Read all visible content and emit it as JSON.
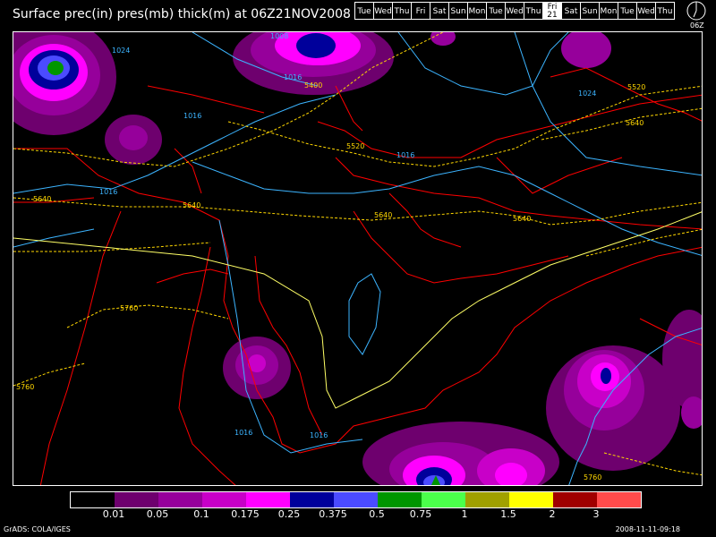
{
  "title": "Surface prec(in) pres(mb) thick(m) at 06Z21NOV2008",
  "days": [
    "Tue",
    "Wed",
    "Thu",
    "Fri",
    "Sat",
    "Sun",
    "Mon",
    "Tue",
    "Wed",
    "Thu",
    "Fri 21",
    "Sat",
    "Sun",
    "Mon",
    "Tue",
    "Wed",
    "Thu"
  ],
  "selected_day": "Fri 21",
  "clock_label": "06Z",
  "legend": {
    "colors": [
      "#000000",
      "#6e006e",
      "#96009b",
      "#c800c8",
      "#ff00ff",
      "#00009b",
      "#4b4bff",
      "#009600",
      "#4bff4b",
      "#a0a000",
      "#ffff00",
      "#a00000",
      "#ff4b4b"
    ],
    "ticks": [
      "0.01",
      "0.05",
      "0.1",
      "0.175",
      "0.25",
      "0.375",
      "0.5",
      "0.75",
      "1",
      "1.5",
      "2",
      "3"
    ]
  },
  "footer_left": "GrADS: COLA/IGES",
  "footer_right": "2008-11-11-09:18",
  "map": {
    "pressure_color": "#3cb4ff",
    "thickness_color": "#ffd700",
    "coast_color": "#ff0000",
    "pressure_labels": [
      "1008",
      "1024",
      "1016",
      "1016",
      "1016",
      "1016",
      "1024",
      "1016",
      "1016"
    ],
    "thickness_labels": [
      "5400",
      "5520",
      "5640",
      "5640",
      "5640",
      "5520",
      "5640",
      "5640",
      "5760",
      "5760",
      "5760"
    ]
  }
}
